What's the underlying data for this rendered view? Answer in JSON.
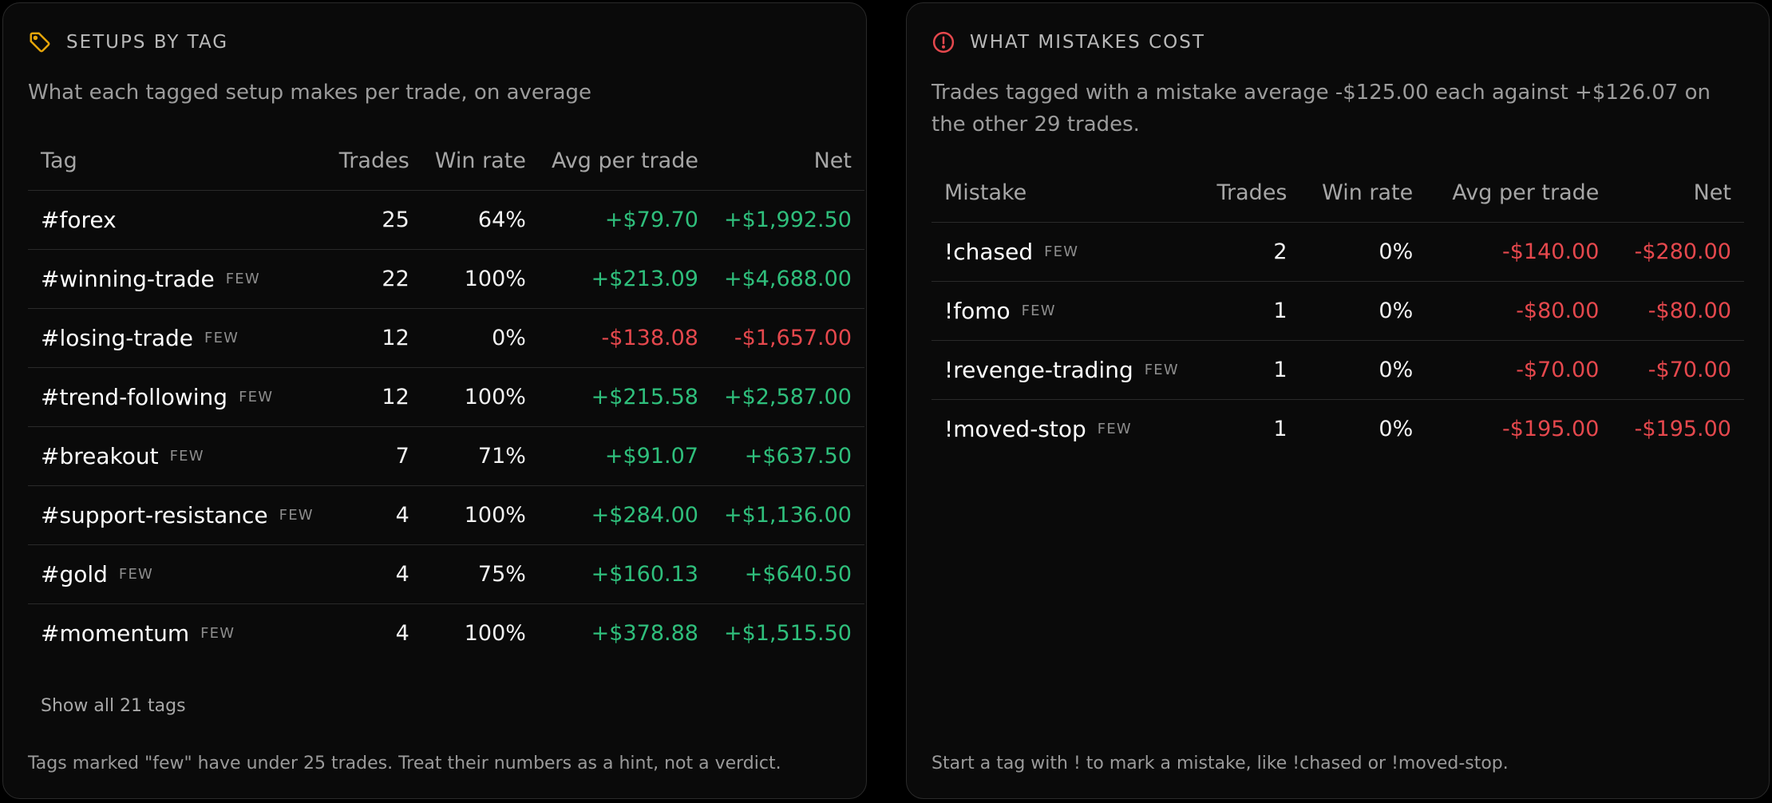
{
  "colors": {
    "positive": "#2fbf7c",
    "negative": "#e5484d",
    "tag_icon": "#e5a50a",
    "alert_icon": "#e5484d"
  },
  "setups": {
    "icon": "tag-icon",
    "title": "SETUPS BY TAG",
    "subtitle": "What each tagged setup makes per trade, on average",
    "columns": [
      "Tag",
      "Trades",
      "Win rate",
      "Avg per trade",
      "Net"
    ],
    "rows": [
      {
        "name": "#forex",
        "few": "",
        "trades": "25",
        "win_rate": "64%",
        "avg": "+$79.70",
        "net": "+$1,992.50",
        "sign": "pos"
      },
      {
        "name": "#winning-trade",
        "few": "FEW",
        "trades": "22",
        "win_rate": "100%",
        "avg": "+$213.09",
        "net": "+$4,688.00",
        "sign": "pos"
      },
      {
        "name": "#losing-trade",
        "few": "FEW",
        "trades": "12",
        "win_rate": "0%",
        "avg": "-$138.08",
        "net": "-$1,657.00",
        "sign": "neg"
      },
      {
        "name": "#trend-following",
        "few": "FEW",
        "trades": "12",
        "win_rate": "100%",
        "avg": "+$215.58",
        "net": "+$2,587.00",
        "sign": "pos"
      },
      {
        "name": "#breakout",
        "few": "FEW",
        "trades": "7",
        "win_rate": "71%",
        "avg": "+$91.07",
        "net": "+$637.50",
        "sign": "pos"
      },
      {
        "name": "#support-resistance",
        "few": "FEW",
        "trades": "4",
        "win_rate": "100%",
        "avg": "+$284.00",
        "net": "+$1,136.00",
        "sign": "pos"
      },
      {
        "name": "#gold",
        "few": "FEW",
        "trades": "4",
        "win_rate": "75%",
        "avg": "+$160.13",
        "net": "+$640.50",
        "sign": "pos"
      },
      {
        "name": "#momentum",
        "few": "FEW",
        "trades": "4",
        "win_rate": "100%",
        "avg": "+$378.88",
        "net": "+$1,515.50",
        "sign": "pos"
      }
    ],
    "show_all_label": "Show all 21 tags",
    "footer": "Tags marked \"few\" have under 25 trades. Treat their numbers as a hint, not a verdict."
  },
  "mistakes": {
    "icon": "alert-circle-icon",
    "title": "WHAT MISTAKES COST",
    "subtitle": "Trades tagged with a mistake average -$125.00 each against +$126.07 on the other 29 trades.",
    "columns": [
      "Mistake",
      "Trades",
      "Win rate",
      "Avg per trade",
      "Net"
    ],
    "rows": [
      {
        "name": "!chased",
        "few": "FEW",
        "trades": "2",
        "win_rate": "0%",
        "avg": "-$140.00",
        "net": "-$280.00",
        "sign": "neg"
      },
      {
        "name": "!fomo",
        "few": "FEW",
        "trades": "1",
        "win_rate": "0%",
        "avg": "-$80.00",
        "net": "-$80.00",
        "sign": "neg"
      },
      {
        "name": "!revenge-trading",
        "few": "FEW",
        "trades": "1",
        "win_rate": "0%",
        "avg": "-$70.00",
        "net": "-$70.00",
        "sign": "neg"
      },
      {
        "name": "!moved-stop",
        "few": "FEW",
        "trades": "1",
        "win_rate": "0%",
        "avg": "-$195.00",
        "net": "-$195.00",
        "sign": "neg"
      }
    ],
    "footer": "Start a tag with ! to mark a mistake, like !chased or !moved-stop."
  }
}
